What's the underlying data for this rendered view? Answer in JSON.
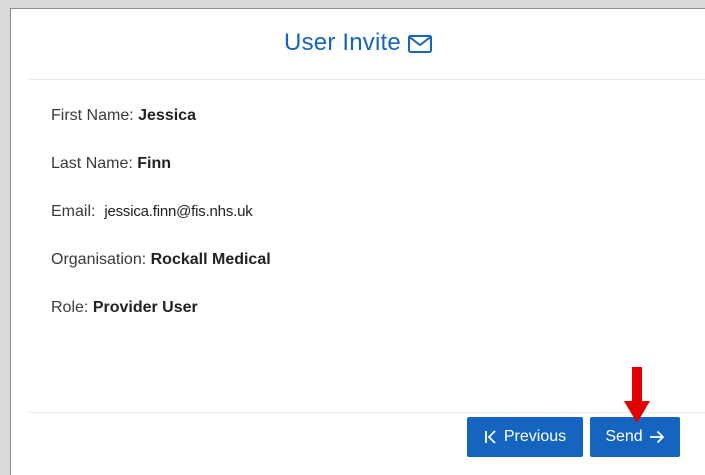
{
  "header": {
    "title": "User Invite",
    "icon": "envelope-icon"
  },
  "fields": [
    {
      "label": "First Name:",
      "value": "Jessica"
    },
    {
      "label": "Last Name:",
      "value": "Finn"
    },
    {
      "label": "Email:",
      "value": "jessica.finn@fis.nhs.uk"
    },
    {
      "label": "Organisation:",
      "value": "Rockall Medical"
    },
    {
      "label": "Role:",
      "value": "Provider User"
    }
  ],
  "buttons": {
    "previous": {
      "label": "Previous",
      "icon": "skip-back-icon"
    },
    "send": {
      "label": "Send",
      "icon": "arrow-right-icon"
    }
  },
  "colors": {
    "accent": "#1565c0",
    "annotation": "#e00000"
  },
  "annotation": {
    "icon": "red-down-arrow-icon"
  }
}
